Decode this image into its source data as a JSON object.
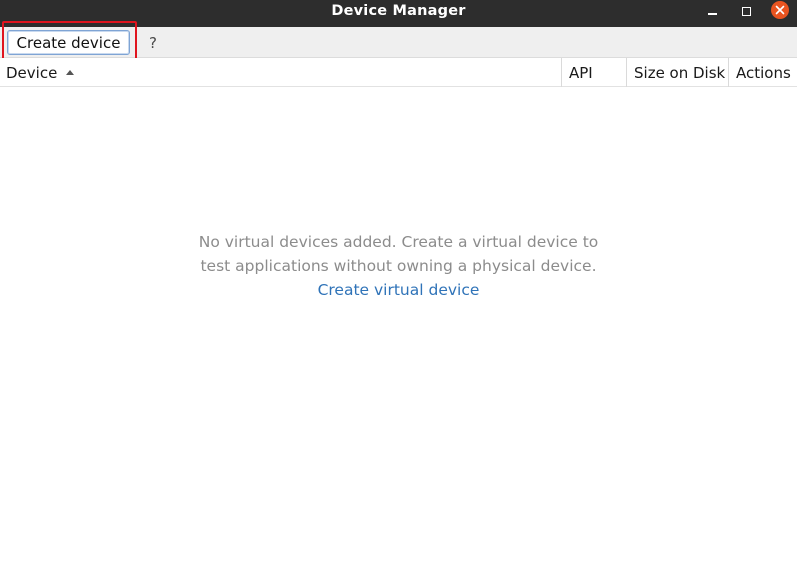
{
  "window": {
    "title": "Device Manager"
  },
  "toolbar": {
    "create_device_label": "Create device",
    "help_label": "?"
  },
  "table": {
    "columns": [
      "Device",
      "API",
      "Size on Disk",
      "Actions"
    ],
    "sort_column": "Device",
    "sort_direction": "ascending"
  },
  "empty_state": {
    "message": "No virtual devices added. Create a virtual device to test applications without owning a physical device.",
    "link_label": "Create virtual device"
  },
  "colors": {
    "titlebar": "#2d2d2d",
    "close_button": "#e95420",
    "link": "#2f73b8",
    "highlight": "#e0141e"
  }
}
